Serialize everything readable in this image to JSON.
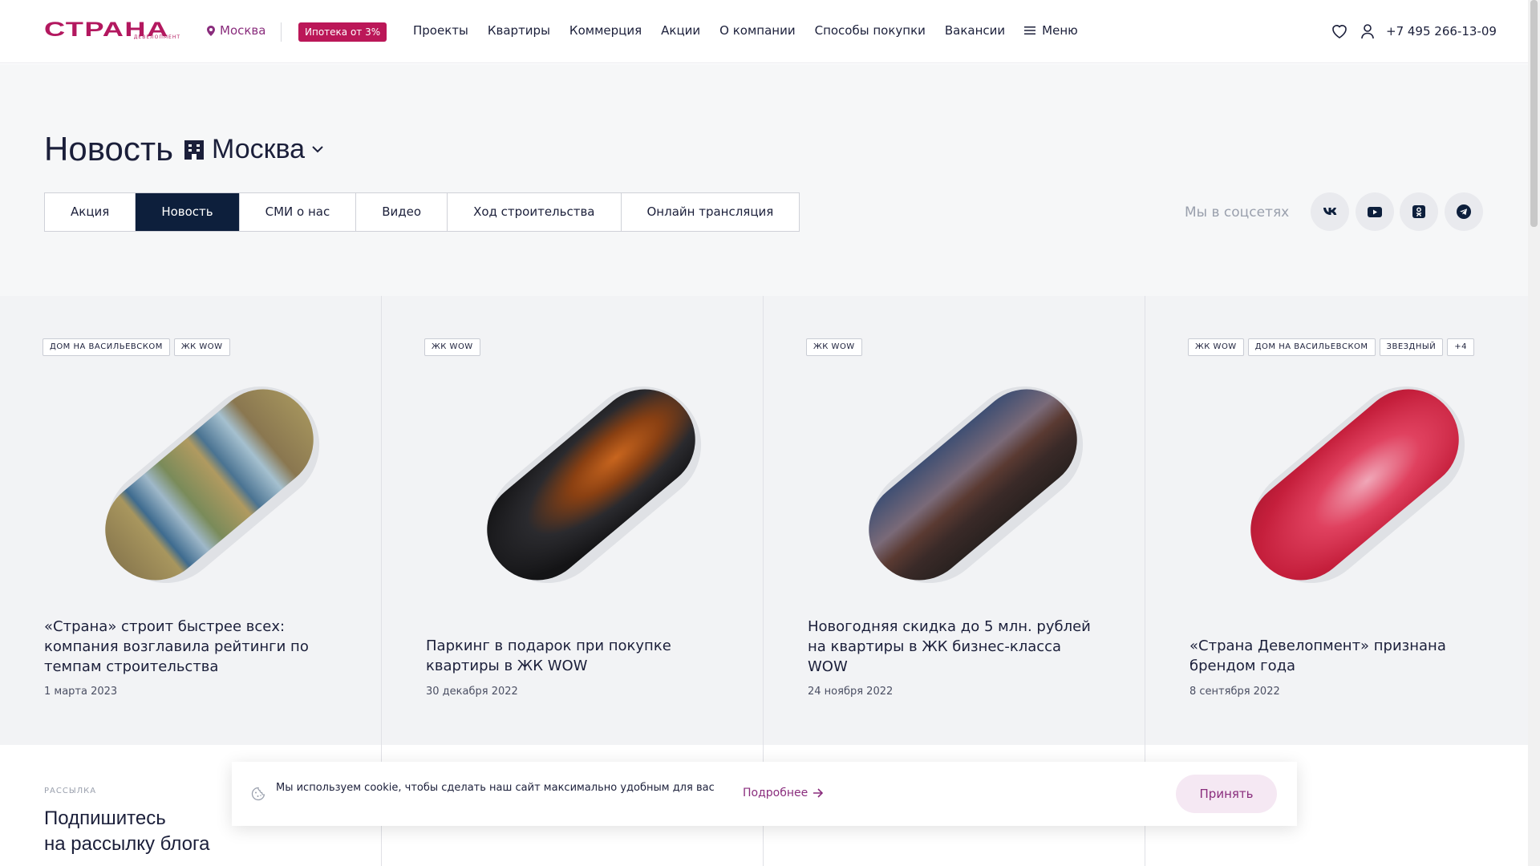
{
  "header": {
    "logo_text": "СТРАНА",
    "logo_sub": "ДЕВЕЛОПМЕНТ",
    "city": "Москва",
    "promo": "Ипотека от 3%",
    "nav": [
      "Проекты",
      "Квартиры",
      "Коммерция",
      "Акции",
      "О компании",
      "Способы покупки",
      "Вакансии"
    ],
    "menu_label": "Меню",
    "phone": "+7 495 266-13-09"
  },
  "page": {
    "title": "Новость",
    "city_select": "Москва"
  },
  "tabs": [
    {
      "label": "Акция",
      "active": false
    },
    {
      "label": "Новость",
      "active": true
    },
    {
      "label": "СМИ о нас",
      "active": false
    },
    {
      "label": "Видео",
      "active": false
    },
    {
      "label": "Ход строительства",
      "active": false
    },
    {
      "label": "Онлайн трансляция",
      "active": false
    }
  ],
  "social": {
    "label": "Мы в соцсетях",
    "icons": [
      "vk-icon",
      "youtube-icon",
      "odnoklassniki-icon",
      "telegram-icon"
    ]
  },
  "cards": [
    {
      "tags": [
        "ДОМ НА ВАСИЛЬЕВСКОМ",
        "ЖК WOW"
      ],
      "title": "«Страна» строит быстрее всех: компания возглавила рейтинги по темпам строительства",
      "date": "1 марта 2023"
    },
    {
      "tags": [
        "ЖК WOW"
      ],
      "title": "Паркинг в подарок при покупке квартиры в ЖК WOW",
      "date": "30 декабря 2022"
    },
    {
      "tags": [
        "ЖК WOW"
      ],
      "title": "Новогодняя скидка до 5 млн. рублей на квартиры в ЖК бизнес-класса WOW",
      "date": "24 ноября 2022"
    },
    {
      "tags": [
        "ЖК WOW",
        "ДОМ НА ВАСИЛЬЕВСКОМ",
        "ЗВЕЗДНЫЙ",
        "+4"
      ],
      "title": "«Страна Девелопмент» признана брендом года",
      "date": "8 сентября 2022"
    }
  ],
  "subscribe": {
    "label": "РАССЫЛКА",
    "title_line1": "Подпишитесь",
    "title_line2": "на рассылку блога"
  },
  "cookie": {
    "text": "Мы используем cookie, чтобы сделать наш сайт максимально удобным для вас",
    "more": "Подробнее",
    "accept": "Принять"
  },
  "colors": {
    "brand": "#b3185f",
    "accent": "#8a2d7d",
    "active_tab": "#0d1f3c"
  }
}
